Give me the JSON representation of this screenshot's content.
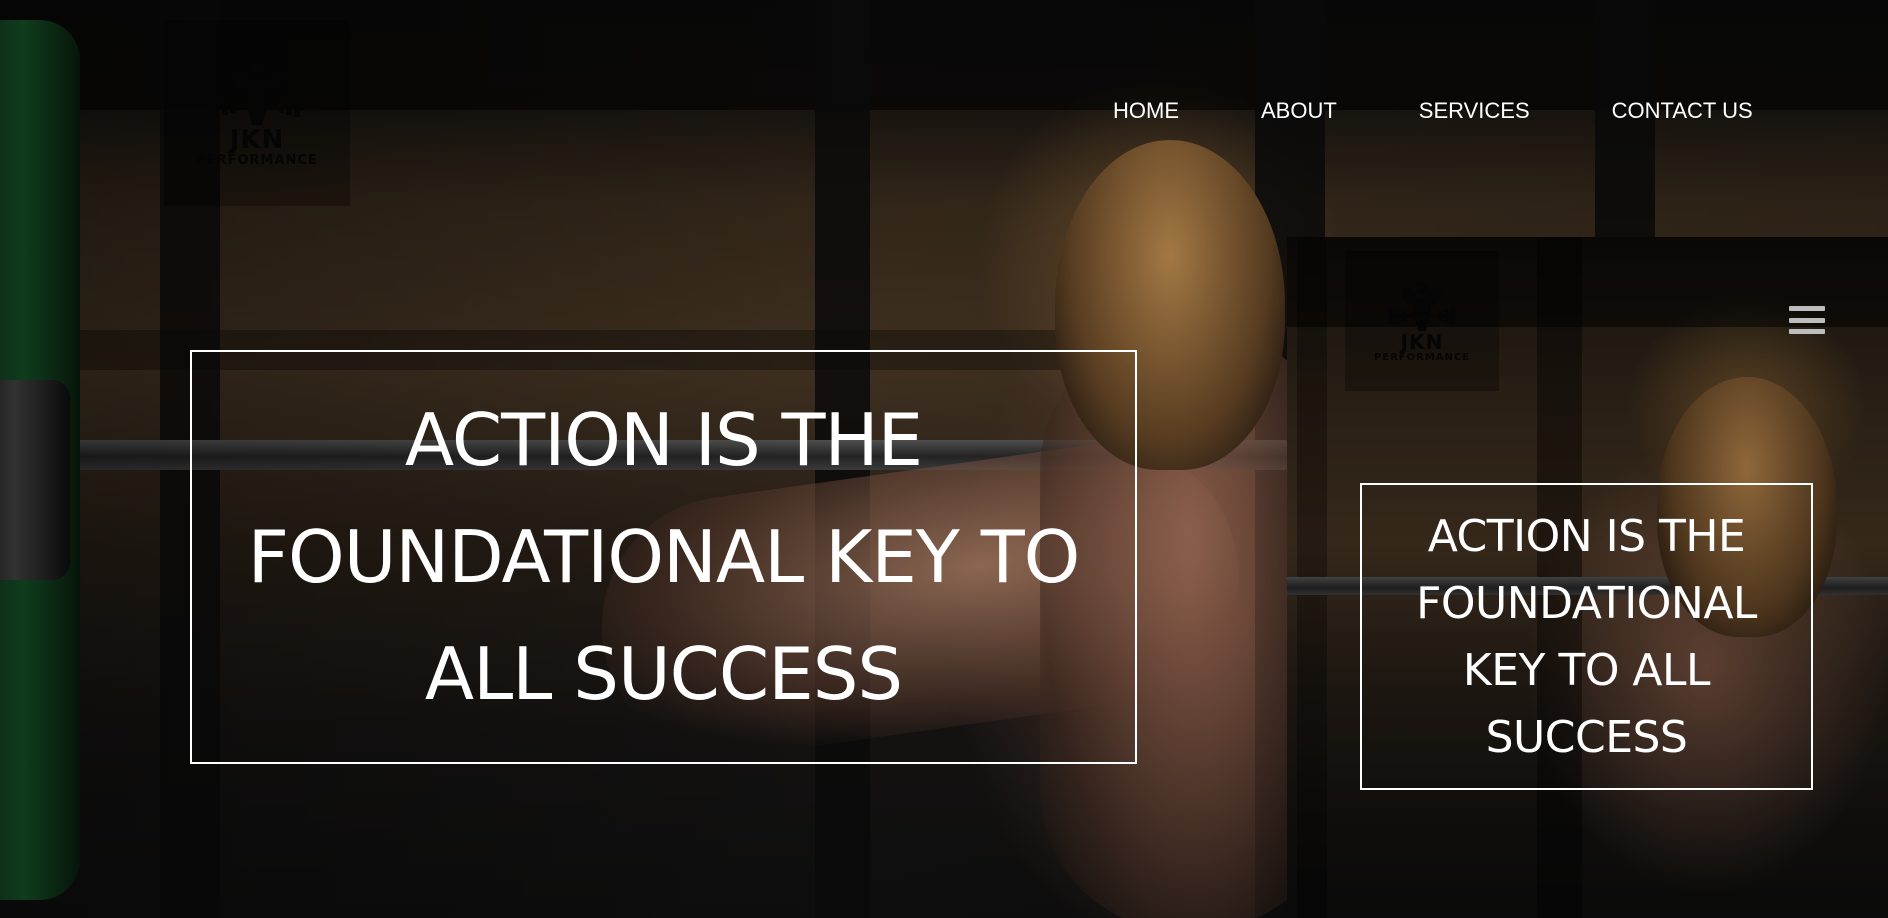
{
  "brand": {
    "logo_line1": "JKN",
    "logo_line2": "PERFORMANCE"
  },
  "nav": {
    "items": [
      {
        "label": "HOME"
      },
      {
        "label": "ABOUT"
      },
      {
        "label": "SERVICES"
      },
      {
        "label": "CONTACT US"
      }
    ]
  },
  "hero": {
    "headline": "ACTION IS THE FOUNDATIONAL KEY TO ALL SUCCESS"
  },
  "mobile": {
    "menu_icon": "hamburger-menu-icon",
    "headline": "ACTION IS THE FOUNDATIONAL KEY TO ALL SUCCESS"
  },
  "colors": {
    "text": "#ffffff",
    "logo": "#050505",
    "menu_icon": "#bdbdbd"
  }
}
